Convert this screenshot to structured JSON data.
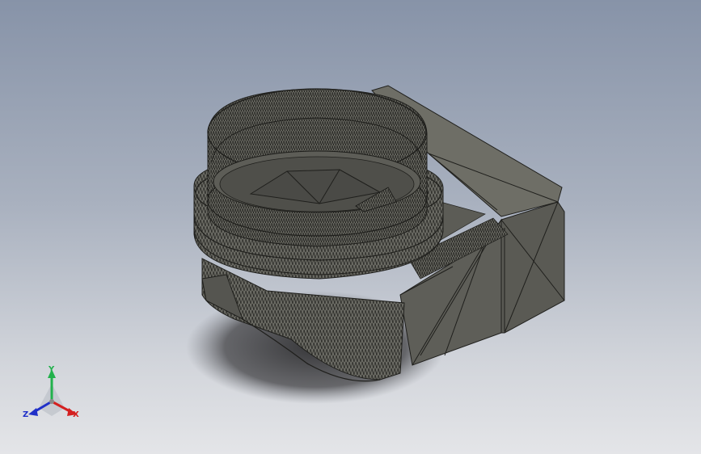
{
  "viewport": {
    "background_top": "#8793a8",
    "background_bottom": "#e4e5e8"
  },
  "model": {
    "display_mode": "shaded-with-edges",
    "body_color": "#6c6c64",
    "edge_color": "#1f1f1c",
    "shadow_color": "#3e3e40"
  },
  "triad": {
    "y_label": "Y",
    "x_label": "X",
    "z_label": "Z",
    "y_color": "#22b14c",
    "x_color": "#d42020",
    "z_color": "#2030c8"
  }
}
